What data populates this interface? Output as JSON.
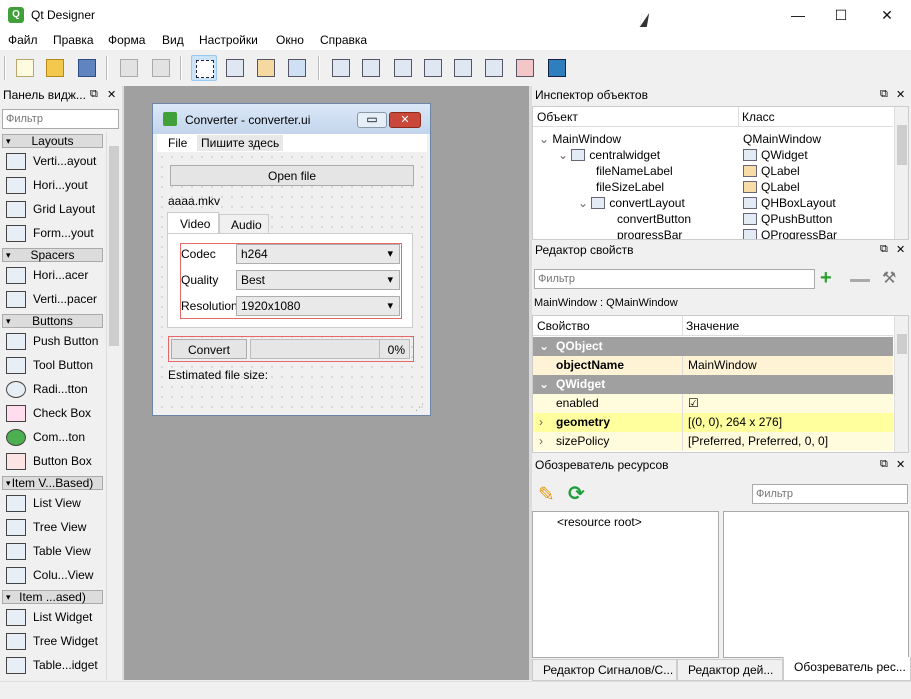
{
  "window": {
    "title": "Qt Designer",
    "app_icon_letter": "Q",
    "minimize": "—",
    "maximize": "☐",
    "close": "✕"
  },
  "menu": [
    "Файл",
    "Правка",
    "Форма",
    "Вид",
    "Настройки",
    "Окно",
    "Справка"
  ],
  "widget_box": {
    "title": "Панель видж...",
    "filter_placeholder": "Фильтр",
    "categories": [
      "Layouts",
      "Spacers",
      "Buttons",
      "Item V...Based)",
      "Item ...ased)"
    ],
    "items": [
      "Verti...ayout",
      "Hori...yout",
      "Grid Layout",
      "Form...yout",
      "Hori...acer",
      "Verti...pacer",
      "Push Button",
      "Tool Button",
      "Radi...tton",
      "Check Box",
      "Com...ton",
      "Button Box",
      "List View",
      "Tree View",
      "Table View",
      "Colu...View",
      "List Widget",
      "Tree Widget",
      "Table...idget"
    ]
  },
  "form": {
    "title": "Converter - converter.ui",
    "menu_file": "File",
    "menu_type_here": "Пишите здесь",
    "open_file_label": "Open file",
    "file_name": "aaaa.mkv",
    "tab_video": "Video",
    "tab_audio": "Audio",
    "codec_label": "Codec",
    "codec_value": "h264",
    "quality_label": "Quality",
    "quality_value": "Best",
    "resolution_label": "Resolution",
    "resolution_value": "1920x1080",
    "convert_label": "Convert",
    "progress_text": "0%",
    "progress": 0,
    "estimated_label": "Estimated file size:"
  },
  "object_inspector": {
    "title": "Инспектор объектов",
    "col_object": "Объект",
    "col_class": "Класс",
    "rows": [
      {
        "object": "MainWindow",
        "class": "QMainWindow"
      },
      {
        "object": "centralwidget",
        "class": "QWidget"
      },
      {
        "object": "fileNameLabel",
        "class": "QLabel"
      },
      {
        "object": "fileSizeLabel",
        "class": "QLabel"
      },
      {
        "object": "convertLayout",
        "class": "QHBoxLayout"
      },
      {
        "object": "convertButton",
        "class": "QPushButton"
      },
      {
        "object": "progressBar",
        "class": "QProgressBar"
      }
    ]
  },
  "property_editor": {
    "title": "Редактор свойств",
    "filter_placeholder": "Фильтр",
    "context": "MainWindow : QMainWindow",
    "col_property": "Свойство",
    "col_value": "Значение",
    "group_qobject": "QObject",
    "group_qwidget": "QWidget",
    "rows": [
      {
        "name": "objectName",
        "value": "MainWindow"
      },
      {
        "name": "enabled",
        "value": "☑"
      },
      {
        "name": "geometry",
        "value": "[(0, 0), 264 x 276]"
      },
      {
        "name": "sizePolicy",
        "value": "[Preferred, Preferred, 0, 0]"
      }
    ]
  },
  "resource_browser": {
    "title": "Обозреватель ресурсов",
    "filter_placeholder": "Фильтр",
    "root": "<resource root>"
  },
  "bottom_tabs": [
    "Редактор Сигналов/С...",
    "Редактор дей...",
    "Обозреватель рес..."
  ],
  "colors": {
    "accent": "#cce4f7",
    "red": "#e86767",
    "group": "#a0a0a0",
    "highlight": "#fffbdd"
  }
}
